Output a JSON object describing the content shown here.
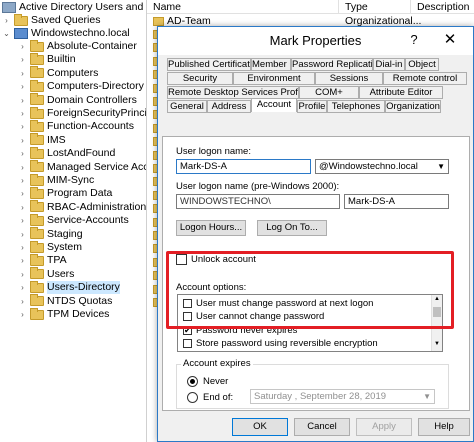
{
  "tree": {
    "root": "Active Directory Users and Computers",
    "items": [
      {
        "label": "Saved Queries"
      },
      {
        "label": "Windowstechno.local"
      },
      {
        "label": "Absolute-Container"
      },
      {
        "label": "Builtin"
      },
      {
        "label": "Computers"
      },
      {
        "label": "Computers-Directory"
      },
      {
        "label": "Domain Controllers"
      },
      {
        "label": "ForeignSecurityPrincipals"
      },
      {
        "label": "Function-Accounts"
      },
      {
        "label": "IMS"
      },
      {
        "label": "LostAndFound"
      },
      {
        "label": "Managed Service Accounts"
      },
      {
        "label": "MIM-Sync"
      },
      {
        "label": "Program Data"
      },
      {
        "label": "RBAC-Administration"
      },
      {
        "label": "Service-Accounts"
      },
      {
        "label": "Staging"
      },
      {
        "label": "System"
      },
      {
        "label": "TPA"
      },
      {
        "label": "Users"
      },
      {
        "label": "Users-Directory"
      },
      {
        "label": "NTDS Quotas"
      },
      {
        "label": "TPM Devices"
      }
    ]
  },
  "list": {
    "columns": [
      "Name",
      "Type",
      "Description"
    ],
    "first_row": {
      "name": "AD-Team",
      "type": "Organizational..."
    }
  },
  "dialog": {
    "title": "Mark Properties",
    "help": "?",
    "close": "✕",
    "tabs_row1": [
      "Published Certificates",
      "Member Of",
      "Password Replication",
      "Dial-in",
      "Object"
    ],
    "tabs_row2": [
      "Security",
      "Environment",
      "Sessions",
      "Remote control"
    ],
    "tabs_row3": [
      "Remote Desktop Services Profile",
      "COM+",
      "Attribute Editor"
    ],
    "tabs_row4": [
      "General",
      "Address",
      "Account",
      "Profile",
      "Telephones",
      "Organization"
    ],
    "logon_label": "User logon name:",
    "logon_value": "Mark-DS-A",
    "domain_value": "@Windowstechno.local",
    "pre2000_label": "User logon name (pre-Windows 2000):",
    "pre2000_domain": "WINDOWSTECHNO\\",
    "pre2000_value": "Mark-DS-A",
    "logon_hours_btn": "Logon Hours...",
    "logon_to_btn": "Log On To...",
    "unlock_label": "Unlock account",
    "account_options_label": "Account options:",
    "account_options": [
      {
        "label": "User must change password at next logon",
        "checked": false
      },
      {
        "label": "User cannot change password",
        "checked": false
      },
      {
        "label": "Password never expires",
        "checked": true
      },
      {
        "label": "Store password using reversible encryption",
        "checked": false
      }
    ],
    "account_expires_label": "Account expires",
    "never_label": "Never",
    "end_of_label": "End of:",
    "end_of_date": "Saturday  ,  September 28, 2019",
    "buttons": {
      "ok": "OK",
      "cancel": "Cancel",
      "apply": "Apply",
      "help": "Help"
    }
  },
  "colors": {
    "highlight": "#e31e24",
    "accent": "#0078d7"
  }
}
